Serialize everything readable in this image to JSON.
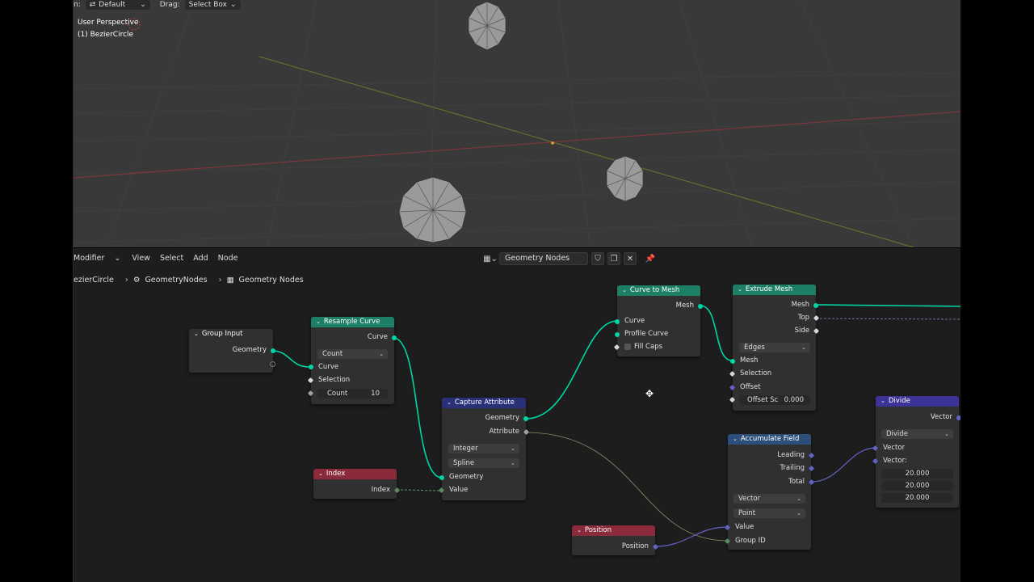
{
  "viewport": {
    "header": {
      "pivot_label_fragment": "n:",
      "pivot_value": "Default",
      "drag_label": "Drag:",
      "drag_value": "Select Box"
    },
    "overlay": {
      "view_name": "User Perspective",
      "object_name": "(1) BezierCircle"
    }
  },
  "editor": {
    "toolbar": {
      "editor_type": "Modifier",
      "menus": [
        "View",
        "Select",
        "Add",
        "Node"
      ],
      "node_tree_name": "Geometry Nodes"
    },
    "breadcrumb": {
      "object": "ezierCircle",
      "modifier": "GeometryNodes",
      "tree": "Geometry Nodes"
    }
  },
  "nodes": {
    "group_input": {
      "title": "Group Input",
      "out_geometry": "Geometry"
    },
    "resample_curve": {
      "title": "Resample Curve",
      "out_curve": "Curve",
      "mode": "Count",
      "in_curve": "Curve",
      "in_selection": "Selection",
      "count_label": "Count",
      "count_value": "10"
    },
    "capture_attribute": {
      "title": "Capture Attribute",
      "out_geometry": "Geometry",
      "out_attribute": "Attribute",
      "data_type": "Integer",
      "domain": "Spline",
      "in_geometry": "Geometry",
      "in_value": "Value"
    },
    "index": {
      "title": "Index",
      "out_index": "Index"
    },
    "curve_to_mesh": {
      "title": "Curve to Mesh",
      "out_mesh": "Mesh",
      "in_curve": "Curve",
      "in_profile": "Profile Curve",
      "fill_caps": "Fill Caps"
    },
    "extrude_mesh": {
      "title": "Extrude Mesh",
      "out_mesh": "Mesh",
      "out_top": "Top",
      "out_side": "Side",
      "mode": "Edges",
      "in_mesh": "Mesh",
      "in_selection": "Selection",
      "in_offset": "Offset",
      "offset_scale_label": "Offset Sc",
      "offset_scale_value": "0.000"
    },
    "accumulate_field": {
      "title": "Accumulate Field",
      "out_leading": "Leading",
      "out_trailing": "Trailing",
      "out_total": "Total",
      "data_type": "Vector",
      "domain": "Point",
      "in_value": "Value",
      "in_group": "Group ID"
    },
    "position": {
      "title": "Position",
      "out_position": "Position"
    },
    "divide": {
      "title": "Divide",
      "out_vector": "Vector",
      "operation": "Divide",
      "in_vector": "Vector",
      "in_vector2": "Vector:",
      "v1": "20.000",
      "v2": "20.000",
      "v3": "20.000"
    }
  },
  "colors": {
    "geometry_socket": "#00d6a3",
    "vector_socket": "#6363c7",
    "header_geometry": "#1e7f67",
    "header_input": "#8a2a3a",
    "header_vector": "#3b3396"
  }
}
